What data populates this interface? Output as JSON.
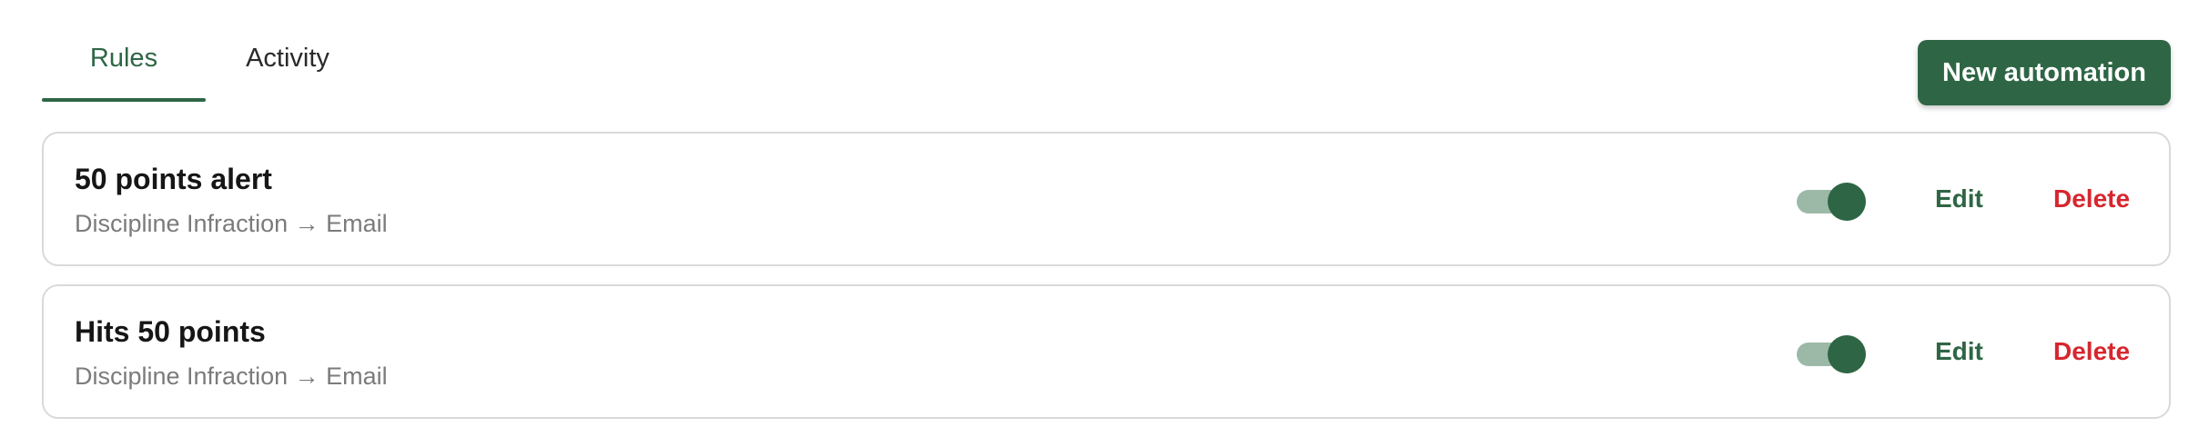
{
  "tabs": [
    {
      "label": "Rules",
      "active": true
    },
    {
      "label": "Activity",
      "active": false
    }
  ],
  "header": {
    "new_button_label": "New automation"
  },
  "colors": {
    "accent": "#2e6645",
    "danger": "#d7262e",
    "toggle_track": "#9cb9a8",
    "border": "#d9d9d9",
    "muted_text": "#7b7b7b"
  },
  "rules": [
    {
      "title": "50 points alert",
      "subtitle": "Discipline Infraction → Email",
      "enabled": true,
      "edit_label": "Edit",
      "delete_label": "Delete"
    },
    {
      "title": "Hits 50 points",
      "subtitle": "Discipline Infraction → Email",
      "enabled": true,
      "edit_label": "Edit",
      "delete_label": "Delete"
    }
  ]
}
